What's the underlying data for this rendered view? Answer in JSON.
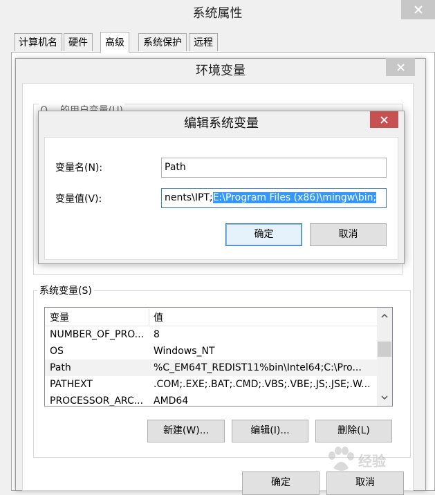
{
  "system_properties": {
    "title": "系统属性",
    "tabs": [
      "计算机名",
      "硬件",
      "高级",
      "系统保护",
      "远程"
    ],
    "active_tab": "高级"
  },
  "env_vars": {
    "title": "环境变量",
    "user_vars_label": "Q... 的用户变量(U)",
    "system_vars_label": "系统变量(S)",
    "columns": {
      "name": "变量",
      "value": "值"
    },
    "rows": [
      {
        "name": "NUMBER_OF_PRO...",
        "value": "8"
      },
      {
        "name": "OS",
        "value": "Windows_NT"
      },
      {
        "name": "Path",
        "value": "%C_EM64T_REDIST11%bin\\Intel64;C:\\Pro..."
      },
      {
        "name": "PATHEXT",
        "value": ".COM;.EXE;.BAT;.CMD;.VBS;.VBE;.JS;.JSE;.W..."
      },
      {
        "name": "PROCESSOR_ARC...",
        "value": "AMD64"
      }
    ],
    "selected_row": "Path",
    "buttons": {
      "new": "新建(W)...",
      "edit": "编辑(I)...",
      "delete": "删除(L)"
    },
    "ok": "确定",
    "cancel": "取消"
  },
  "edit_dialog": {
    "title": "编辑系统变量",
    "name_label": "变量名(N):",
    "name_value": "Path",
    "value_label": "变量值(V):",
    "value_prefix": "nents\\IPT;",
    "value_selected": "E:\\Program Files (x86)\\mingw\\bin;",
    "ok": "确定",
    "cancel": "取消"
  },
  "watermark": {
    "text": "经验"
  },
  "colors": {
    "selection": "#3399ff",
    "close_red": "#c75050",
    "primary_border": "#3c7fb1"
  }
}
